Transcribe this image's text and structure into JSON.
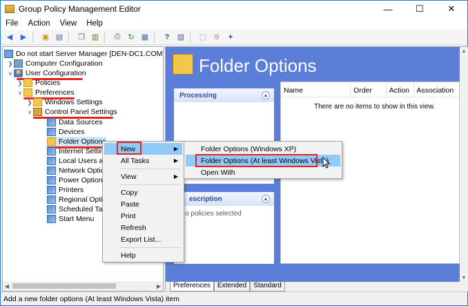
{
  "window": {
    "title": "Group Policy Management Editor"
  },
  "menubar": [
    "File",
    "Action",
    "View",
    "Help"
  ],
  "tree": {
    "root": "Do not start Server Manager [DEN-DC1.COMPANY.",
    "computer_configuration": "Computer Configuration",
    "user_configuration": "User Configuration",
    "policies": "Policies",
    "preferences": "Preferences",
    "windows_settings": "Windows Settings",
    "control_panel_settings": "Control Panel Settings",
    "items": [
      "Data Sources",
      "Devices",
      "Folder Options",
      "Internet Setting",
      "Local Users and",
      "Network Option",
      "Power Options",
      "Printers",
      "Regional Option",
      "Scheduled Task",
      "Start Menu"
    ]
  },
  "banner": {
    "title": "Folder Options"
  },
  "panels": {
    "processing": "Processing",
    "description": "escription",
    "description_text": "o policies selected"
  },
  "list": {
    "columns": [
      "Name",
      "Order",
      "Action",
      "Association"
    ],
    "empty_text": "There are no items to show in this view."
  },
  "tabs": [
    "Preferences",
    "Extended",
    "Standard"
  ],
  "context_menu": {
    "new": "New",
    "all_tasks": "All Tasks",
    "view": "View",
    "copy": "Copy",
    "paste": "Paste",
    "print": "Print",
    "refresh": "Refresh",
    "export": "Export List...",
    "help": "Help"
  },
  "submenu": {
    "xp": "Folder Options (Windows XP)",
    "vista": "Folder Options (At least Windows Vista)",
    "open_with": "Open With"
  },
  "status": "Add a new folder options (At least Windows Vista) item",
  "colors": {
    "accent_red": "#e8231e",
    "banner_blue": "#5b7fd8",
    "highlight": "#91c9f7"
  }
}
